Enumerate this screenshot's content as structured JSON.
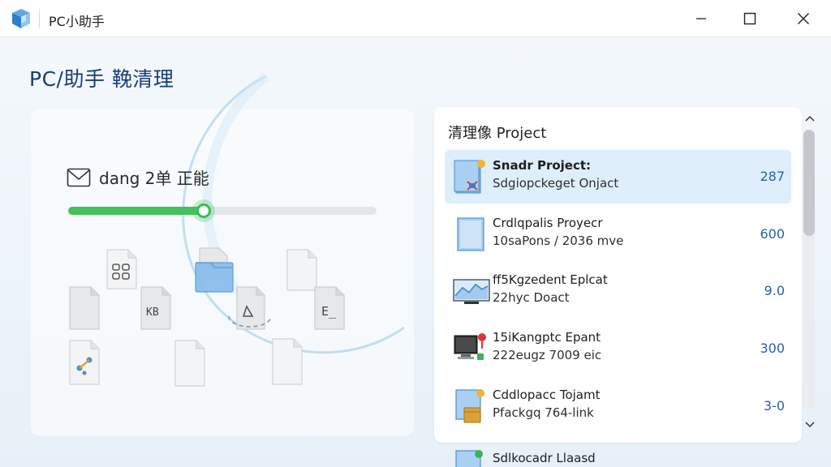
{
  "window": {
    "title": "PC小助手",
    "controls": [
      "minimize",
      "maximize",
      "close"
    ]
  },
  "main": {
    "page_title": "PC/助手 鞔清理"
  },
  "cleanup": {
    "status_text": "dang 2单 正能",
    "progress_fraction": 0.44
  },
  "projects": {
    "header": "清理像 Project",
    "items": [
      {
        "name": "Snadr Project:",
        "desc": "Sdgiopckeget Onjact",
        "value": "287",
        "selected": true,
        "thumb": "blue-folder-icon"
      },
      {
        "name": "Crdlqpalis Proyecr",
        "desc": "10saPons / 2036 mve",
        "value": "600",
        "selected": false,
        "thumb": "blue-document-icon"
      },
      {
        "name": "ff5Kgzedent Eplcat",
        "desc": "22hyc Doact",
        "value": "9.0",
        "selected": false,
        "thumb": "monitor-chart-icon"
      },
      {
        "name": "15iKangptc Epant",
        "desc": "222eugz 7009 eic",
        "value": "300",
        "selected": false,
        "thumb": "computer-pin-icon"
      },
      {
        "name": "Cddlopacc Tojamt",
        "desc": "Pfackgq 764-link",
        "value": "3-0",
        "selected": false,
        "thumb": "project-box-icon"
      }
    ],
    "partial_item": {
      "name": "Sdlkocadr Llaasd"
    }
  },
  "scroll": {
    "position_fraction": 0.0,
    "visible_fraction": 0.38
  },
  "colors": {
    "accent": "#2a5fa8",
    "title": "#183d73",
    "progress": "#42c15c",
    "selected_row": "#dfeefb"
  }
}
